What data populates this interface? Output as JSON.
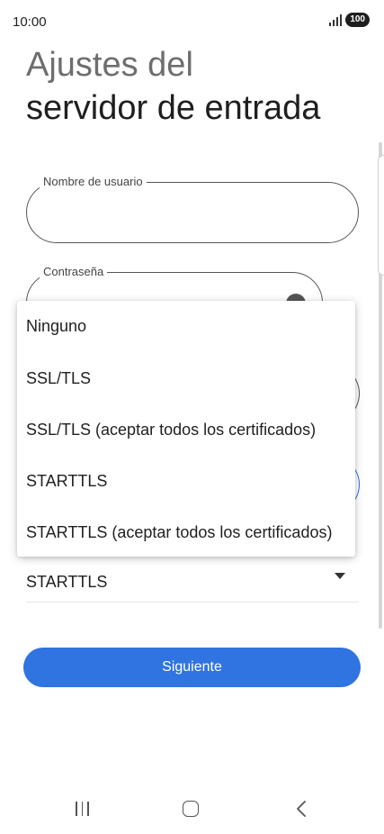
{
  "status_bar": {
    "time": "10:00",
    "battery": "100"
  },
  "header": {
    "title_line1": "Ajustes del",
    "title_line2": "servidor de entrada"
  },
  "form": {
    "username_label": "Nombre de usuario",
    "username_value": "",
    "password_label": "Contraseña",
    "password_value": ""
  },
  "security_menu": {
    "options": [
      "Ninguno",
      "SSL/TLS",
      "SSL/TLS (aceptar todos los certificados)",
      "STARTTLS",
      "STARTTLS (aceptar todos los certificados)"
    ]
  },
  "security_select": {
    "value": "STARTTLS"
  },
  "actions": {
    "next_label": "Siguiente"
  },
  "colors": {
    "accent": "#2f74e0"
  },
  "icons": {
    "nav_recents": "recents-icon",
    "nav_home": "home-icon",
    "nav_back": "back-icon",
    "password_toggle": "eye-icon",
    "dropdown": "arrow-drop-down-icon"
  }
}
